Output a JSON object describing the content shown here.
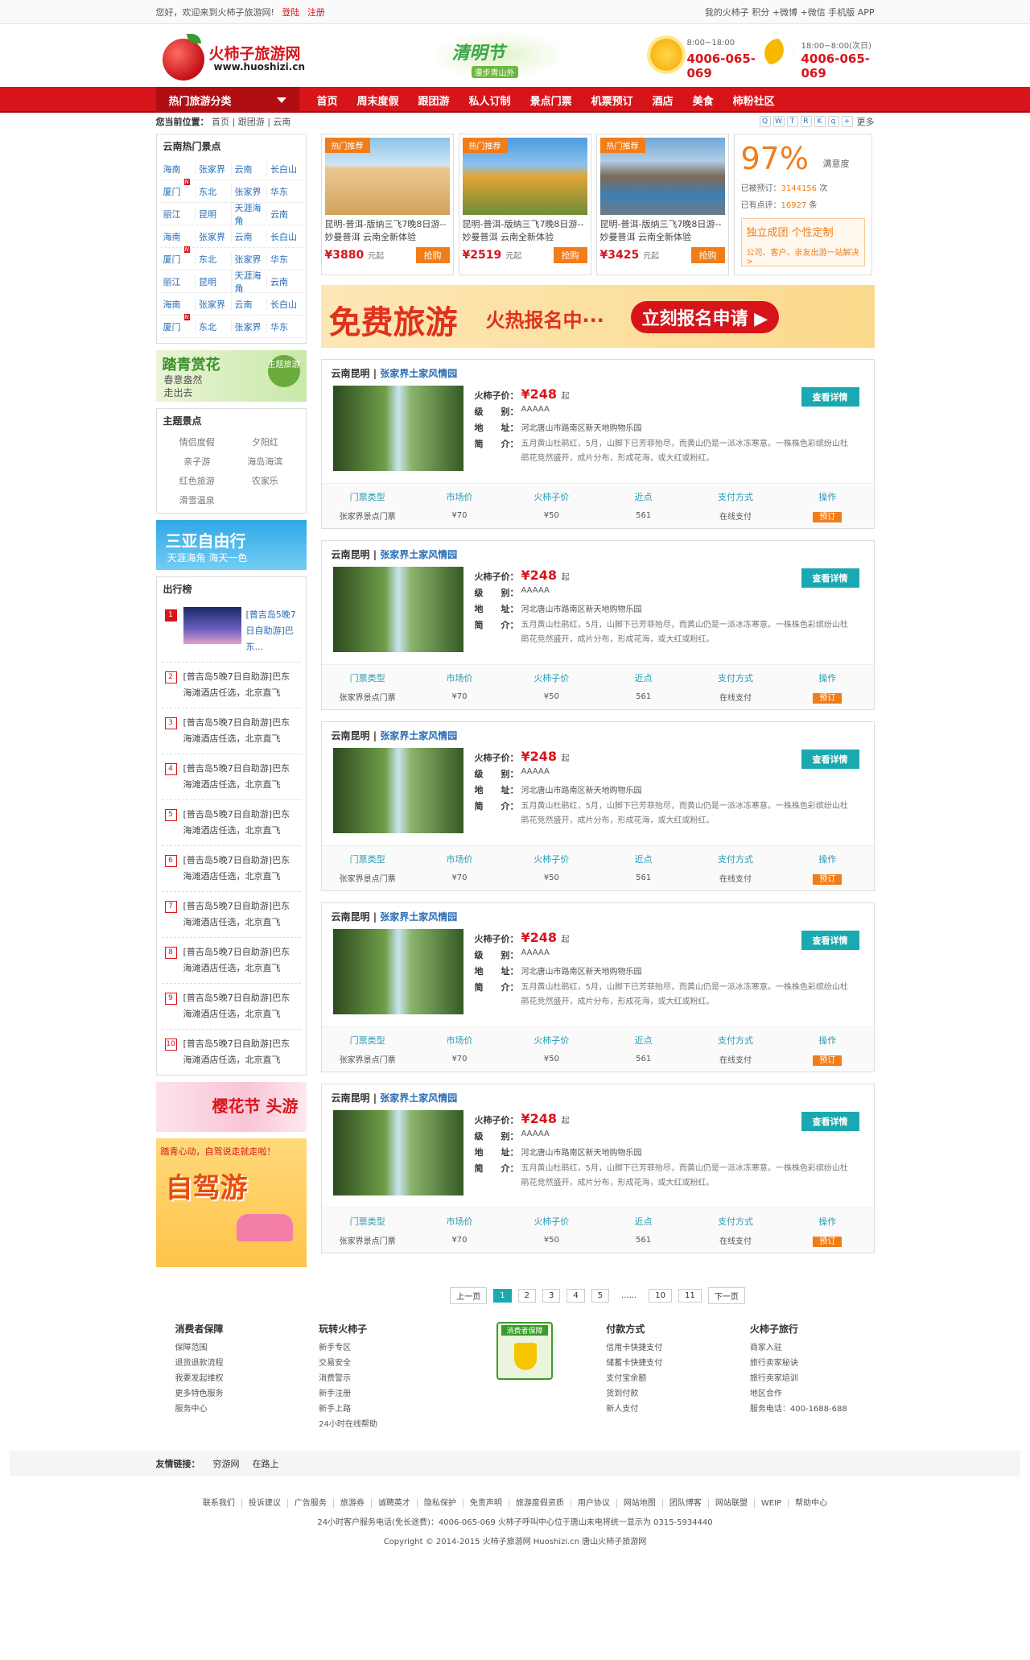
{
  "topbar": {
    "welcome": "您好，欢迎来到火柿子旅游网!",
    "login": "登陆",
    "register": "注册",
    "links": [
      "我的火柿子",
      "积分",
      "+微博",
      "+微信",
      "手机版 APP"
    ]
  },
  "header": {
    "logo_name": "火柿子旅游网",
    "logo_url": "www.huoshizi.cn",
    "spring_title": "清明节",
    "spring_sub": "漫步青山外",
    "day_hours": "8:00~18:00",
    "day_phone": "4006-065-069",
    "night_hours": "18:00~8:00(次日)",
    "night_phone": "4006-065-069"
  },
  "nav": {
    "category": "热门旅游分类",
    "items": [
      "首页",
      "周末度假",
      "跟团游",
      "私人订制",
      "景点门票",
      "机票预订",
      "酒店",
      "美食",
      "柿粉社区"
    ]
  },
  "breadcrumb": {
    "label": "您当前位置：",
    "path": [
      "首页",
      "跟团游",
      "云南"
    ],
    "more": "更多"
  },
  "sidebar": {
    "hot_title": "云南热门景点",
    "hot_rows": [
      [
        "海南",
        "张家界",
        "云南",
        "长白山"
      ],
      [
        "厦门",
        "东北",
        "张家界",
        "华东"
      ],
      [
        "丽江",
        "昆明",
        "天涯海角",
        "云南"
      ],
      [
        "海南",
        "张家界",
        "云南",
        "长白山"
      ],
      [
        "厦门",
        "东北",
        "张家界",
        "华东"
      ],
      [
        "丽江",
        "昆明",
        "天涯海角",
        "云南"
      ],
      [
        "海南",
        "张家界",
        "云南",
        "长白山"
      ],
      [
        "厦门",
        "东北",
        "张家界",
        "华东"
      ]
    ],
    "new_badge": "N",
    "spring_banner": {
      "title": "踏青赏花",
      "line1": "春意盎然",
      "line2": "走出去",
      "tag": "主题旅游"
    },
    "theme_title": "主题景点",
    "themes": [
      "情侣度假",
      "夕阳红",
      "亲子游",
      "海岛海滨",
      "红色旅游",
      "农家乐",
      "滑雪温泉"
    ],
    "sanya": {
      "title": "三亚自由行",
      "sub": "天涯海角 海天一色"
    },
    "rank_title": "出行榜",
    "rank_first": "[普吉岛5晚7日自助游]巴东...",
    "rank_text": "[普吉岛5晚7日自助游]巴东海滩酒店任选，北京直飞",
    "rank_nums": [
      "1",
      "2",
      "3",
      "4",
      "5",
      "6",
      "7",
      "8",
      "9",
      "10"
    ],
    "sakura": "樱花节 头游",
    "drive": {
      "top": "踏青心动，自驾说走就走啦！",
      "title": "自驾游"
    }
  },
  "top_products": [
    {
      "tag": "热门推荐",
      "desc": "昆明-普洱-版纳三飞7晚8日游--妙曼普洱 云南全新体验",
      "price": "¥3880",
      "unit": "元起",
      "btn": "抢购"
    },
    {
      "tag": "热门推荐",
      "desc": "昆明-普洱-版纳三飞7晚8日游--妙曼普洱 云南全新体验",
      "price": "¥2519",
      "unit": "元起",
      "btn": "抢购"
    },
    {
      "tag": "热门推荐",
      "desc": "昆明-普洱-版纳三飞7晚8日游--妙曼普洱 云南全新体验",
      "price": "¥3425",
      "unit": "元起",
      "btn": "抢购"
    }
  ],
  "satisfaction": {
    "pct": "97%",
    "label": "满意度",
    "booked_label": "已被预订：",
    "booked": "3144156",
    "booked_unit": "次",
    "review_label": "已有点评：",
    "reviews": "16927",
    "review_unit": "条",
    "custom_title": "独立成团  个性定制",
    "custom_sub": "公司、客户、亲友出游一站解决>"
  },
  "free_banner": {
    "t1": "免费旅游",
    "t2": "火热报名中···",
    "t3": "立刻报名申请 ▶"
  },
  "items": [
    {
      "region": "云南昆明",
      "name": "张家界土家风情园",
      "price_label": "火柿子价：",
      "price": "¥248",
      "price_unit": "起",
      "level_label": "级　　别：",
      "level": "AAAAA",
      "addr_label": "地　　址：",
      "addr": "河北唐山市路南区新天地购物乐园",
      "intro_label": "简　　介：",
      "intro": "五月黄山杜鹃红，5月，山脚下已芳菲殆尽，而黄山仍是一派冰冻寒意。一株株色彩缤纷山杜鹃花竞然盛开，成片分布，形成花海，或大红或粉红。",
      "detail": "查看详情",
      "cols": [
        {
          "h": "门票类型",
          "d": "张家界景点门票"
        },
        {
          "h": "市场价",
          "d": "¥70"
        },
        {
          "h": "火柿子价",
          "d": "¥50"
        },
        {
          "h": "近点",
          "d": "561"
        },
        {
          "h": "支付方式",
          "d": "在线支付"
        },
        {
          "h": "操作",
          "d": "预订"
        }
      ]
    },
    {
      "region": "云南昆明",
      "name": "张家界土家风情园",
      "price_label": "火柿子价：",
      "price": "¥248",
      "price_unit": "起",
      "level_label": "级　　别：",
      "level": "AAAAA",
      "addr_label": "地　　址：",
      "addr": "河北唐山市路南区新天地购物乐园",
      "intro_label": "简　　介：",
      "intro": "五月黄山杜鹃红，5月，山脚下已芳菲殆尽，而黄山仍是一派冰冻寒意。一株株色彩缤纷山杜鹃花竞然盛开，成片分布，形成花海，或大红或粉红。",
      "detail": "查看详情",
      "cols": [
        {
          "h": "门票类型",
          "d": "张家界景点门票"
        },
        {
          "h": "市场价",
          "d": "¥70"
        },
        {
          "h": "火柿子价",
          "d": "¥50"
        },
        {
          "h": "近点",
          "d": "561"
        },
        {
          "h": "支付方式",
          "d": "在线支付"
        },
        {
          "h": "操作",
          "d": "预订"
        }
      ]
    },
    {
      "region": "云南昆明",
      "name": "张家界土家风情园",
      "price_label": "火柿子价：",
      "price": "¥248",
      "price_unit": "起",
      "level_label": "级　　别：",
      "level": "AAAAA",
      "addr_label": "地　　址：",
      "addr": "河北唐山市路南区新天地购物乐园",
      "intro_label": "简　　介：",
      "intro": "五月黄山杜鹃红，5月，山脚下已芳菲殆尽，而黄山仍是一派冰冻寒意。一株株色彩缤纷山杜鹃花竞然盛开，成片分布，形成花海，或大红或粉红。",
      "detail": "查看详情",
      "cols": [
        {
          "h": "门票类型",
          "d": "张家界景点门票"
        },
        {
          "h": "市场价",
          "d": "¥70"
        },
        {
          "h": "火柿子价",
          "d": "¥50"
        },
        {
          "h": "近点",
          "d": "561"
        },
        {
          "h": "支付方式",
          "d": "在线支付"
        },
        {
          "h": "操作",
          "d": "预订"
        }
      ]
    },
    {
      "region": "云南昆明",
      "name": "张家界土家风情园",
      "price_label": "火柿子价：",
      "price": "¥248",
      "price_unit": "起",
      "level_label": "级　　别：",
      "level": "AAAAA",
      "addr_label": "地　　址：",
      "addr": "河北唐山市路南区新天地购物乐园",
      "intro_label": "简　　介：",
      "intro": "五月黄山杜鹃红，5月，山脚下已芳菲殆尽，而黄山仍是一派冰冻寒意。一株株色彩缤纷山杜鹃花竞然盛开，成片分布，形成花海，或大红或粉红。",
      "detail": "查看详情",
      "cols": [
        {
          "h": "门票类型",
          "d": "张家界景点门票"
        },
        {
          "h": "市场价",
          "d": "¥70"
        },
        {
          "h": "火柿子价",
          "d": "¥50"
        },
        {
          "h": "近点",
          "d": "561"
        },
        {
          "h": "支付方式",
          "d": "在线支付"
        },
        {
          "h": "操作",
          "d": "预订"
        }
      ]
    },
    {
      "region": "云南昆明",
      "name": "张家界土家风情园",
      "price_label": "火柿子价：",
      "price": "¥248",
      "price_unit": "起",
      "level_label": "级　　别：",
      "level": "AAAAA",
      "addr_label": "地　　址：",
      "addr": "河北唐山市路南区新天地购物乐园",
      "intro_label": "简　　介：",
      "intro": "五月黄山杜鹃红，5月，山脚下已芳菲殆尽，而黄山仍是一派冰冻寒意。一株株色彩缤纷山杜鹃花竞然盛开，成片分布，形成花海，或大红或粉红。",
      "detail": "查看详情",
      "cols": [
        {
          "h": "门票类型",
          "d": "张家界景点门票"
        },
        {
          "h": "市场价",
          "d": "¥70"
        },
        {
          "h": "火柿子价",
          "d": "¥50"
        },
        {
          "h": "近点",
          "d": "561"
        },
        {
          "h": "支付方式",
          "d": "在线支付"
        },
        {
          "h": "操作",
          "d": "预订"
        }
      ]
    }
  ],
  "pager": {
    "prev": "上一页",
    "pages": [
      "1",
      "2",
      "3",
      "4",
      "5"
    ],
    "dots": "......",
    "tail": [
      "10",
      "11"
    ],
    "next": "下一页"
  },
  "footer": {
    "cols": [
      {
        "title": "消费者保障",
        "lines": [
          "保障范围",
          "退货退款流程",
          "我要发起维权",
          "更多特色服务",
          "服务中心"
        ]
      },
      {
        "title": "玩转火柿子",
        "lines": [
          "新手专区",
          "交易安全",
          "消费警示",
          "新手注册",
          "新手上路",
          "24小时在线帮助"
        ]
      },
      {
        "title": "付款方式",
        "lines": [
          "信用卡快捷支付",
          "储蓄卡快捷支付",
          "支付宝余额",
          "货到付款",
          "新人支付"
        ]
      },
      {
        "title": "火柿子旅行",
        "lines": [
          "商家入驻",
          "旅行卖家秘诀",
          "旅行卖家培训",
          "地区合作",
          "服务电话：400-1688-688"
        ]
      }
    ],
    "badge": "消费者保障",
    "friend_label": "友情链接：",
    "friends": [
      "穷游网",
      "在路上"
    ],
    "bottom_links": [
      "联系我们",
      "投诉建议",
      "广告服务",
      "旅游券",
      "诚聘英才",
      "隐私保护",
      "免责声明",
      "旅游度假资质",
      "用户协议",
      "网站地图",
      "团队博客",
      "网站联盟",
      "WEIP",
      "帮助中心"
    ],
    "service": "24小时客户服务电话(免长途费)：4006-065-069 火柿子呼叫中心位于唐山未电将统一显示为 0315-5934440",
    "copyright": "Copyright © 2014-2015 火柿子旅游网 Huoshizi.cn 唐山火柿子旅游网"
  }
}
